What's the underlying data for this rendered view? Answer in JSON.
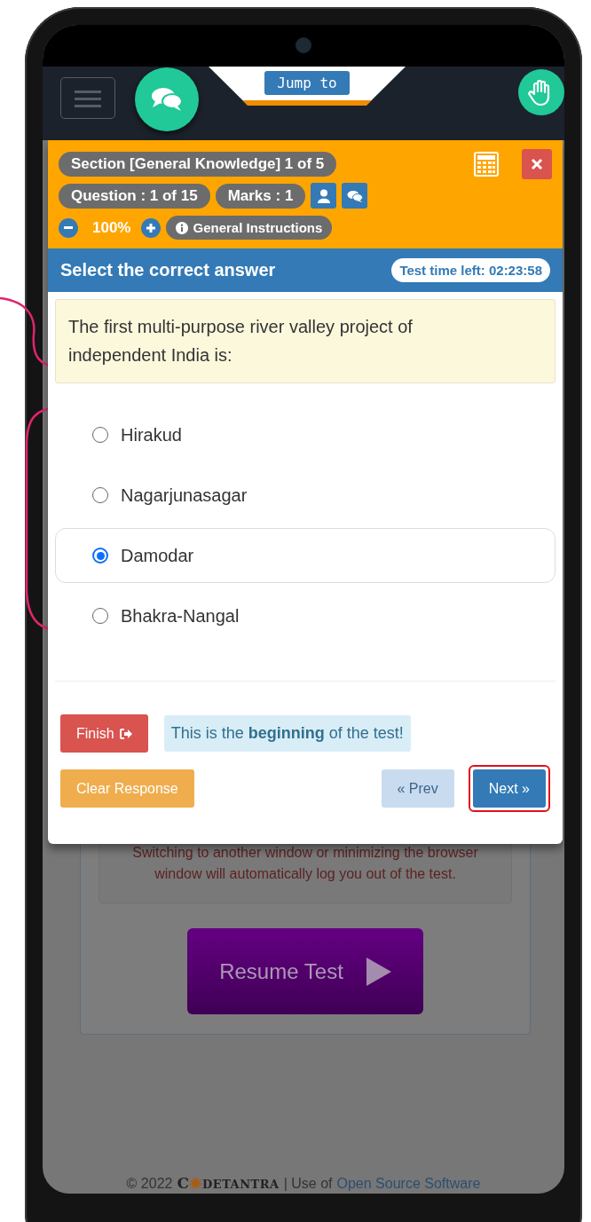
{
  "navbar": {
    "jump_button": "Jump to"
  },
  "modal": {
    "section_label": "Section [General Knowledge] 1 of 5",
    "question_label": "Question : 1 of 15",
    "marks_label": "Marks : 1",
    "zoom_level": "100%",
    "instructions_button": "General Instructions",
    "instruction_heading": "Select the correct answer",
    "timer": "Test time left: 02:23:58",
    "question": "The first multi-purpose river valley project of independent India is:",
    "options": [
      {
        "label": "Hirakud",
        "selected": false
      },
      {
        "label": "Nagarjunasagar",
        "selected": false
      },
      {
        "label": "Damodar",
        "selected": true
      },
      {
        "label": "Bhakra-Nangal",
        "selected": false
      }
    ],
    "finish_button": "Finish",
    "notice": "This is the **beginning** of the test!",
    "clear_button": "Clear Response",
    "prev_button": {
      "label": "« Prev",
      "disabled": true
    },
    "next_button": {
      "label": "Next »",
      "disabled": false,
      "highlighted": true
    }
  },
  "background_page": {
    "warning": "Switching to another window or minimizing the browser window will automatically log you out of the test.",
    "resume_button": "Resume Test"
  },
  "footer": {
    "copyright": "© 2022",
    "logo_start": "C",
    "logo_end": "DETANTRA",
    "text": "| Use of",
    "link": "Open Source Software"
  }
}
